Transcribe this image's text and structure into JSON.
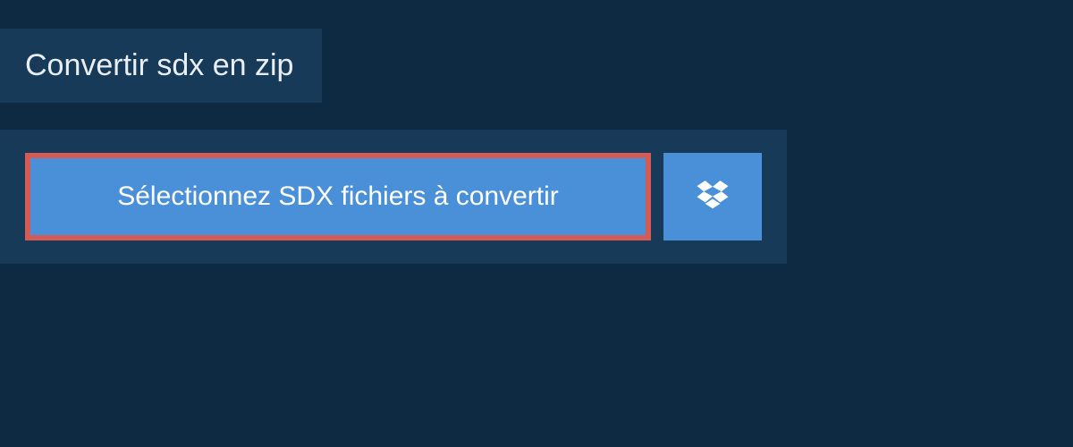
{
  "header": {
    "title": "Convertir sdx en zip"
  },
  "actions": {
    "select_label": "Sélectionnez SDX fichiers à convertir"
  },
  "colors": {
    "bg": "#0e2a42",
    "panel": "#163a57",
    "button": "#4a90d9",
    "highlight_border": "#d35a55"
  }
}
